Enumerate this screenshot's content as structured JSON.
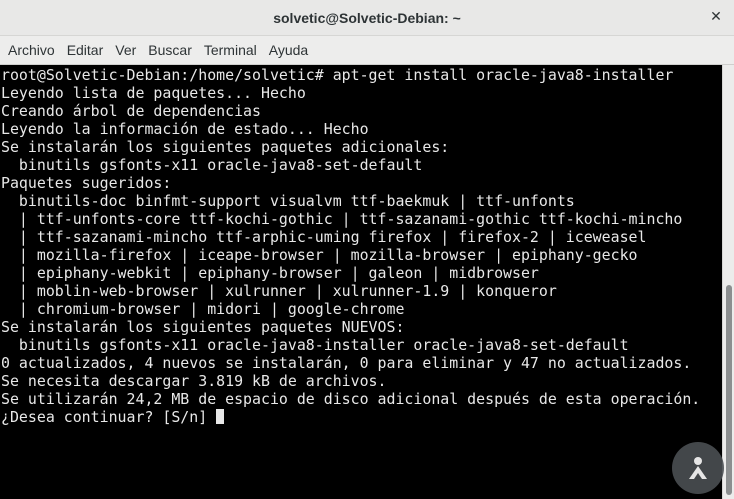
{
  "window": {
    "title": "solvetic@Solvetic-Debian: ~",
    "close_glyph": "✕"
  },
  "menubar": {
    "items": [
      "Archivo",
      "Editar",
      "Ver",
      "Buscar",
      "Terminal",
      "Ayuda"
    ]
  },
  "terminal": {
    "lines": [
      "root@Solvetic-Debian:/home/solvetic# apt-get install oracle-java8-installer",
      "Leyendo lista de paquetes... Hecho",
      "Creando árbol de dependencias",
      "Leyendo la información de estado... Hecho",
      "Se instalarán los siguientes paquetes adicionales:",
      "  binutils gsfonts-x11 oracle-java8-set-default",
      "Paquetes sugeridos:",
      "  binutils-doc binfmt-support visualvm ttf-baekmuk | ttf-unfonts",
      "  | ttf-unfonts-core ttf-kochi-gothic | ttf-sazanami-gothic ttf-kochi-mincho",
      "  | ttf-sazanami-mincho ttf-arphic-uming firefox | firefox-2 | iceweasel",
      "  | mozilla-firefox | iceape-browser | mozilla-browser | epiphany-gecko",
      "  | epiphany-webkit | epiphany-browser | galeon | midbrowser",
      "  | moblin-web-browser | xulrunner | xulrunner-1.9 | konqueror",
      "  | chromium-browser | midori | google-chrome",
      "Se instalarán los siguientes paquetes NUEVOS:",
      "  binutils gsfonts-x11 oracle-java8-installer oracle-java8-set-default",
      "0 actualizados, 4 nuevos se instalarán, 0 para eliminar y 47 no actualizados.",
      "Se necesita descargar 3.819 kB de archivos.",
      "Se utilizarán 24,2 MB de espacio de disco adicional después de esta operación.",
      "¿Desea continuar? [S/n] "
    ]
  },
  "colors": {
    "terminal_bg": "#000000",
    "terminal_fg": "#e8e8e8",
    "titlebar_bg": "#e8e8e7",
    "menubar_bg": "#ededec"
  }
}
